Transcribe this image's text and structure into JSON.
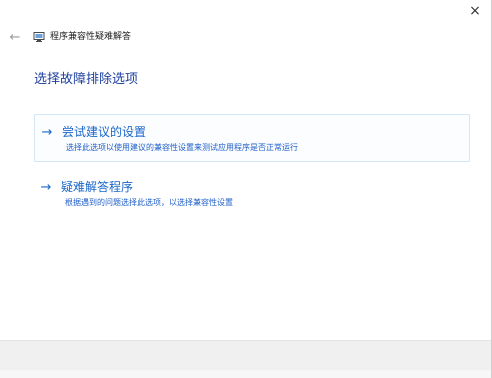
{
  "window": {
    "close_glyph": "×",
    "back_glyph": "←",
    "title": "程序兼容性疑难解答",
    "app_icon": "troubleshooter-app-icon"
  },
  "main": {
    "heading": "选择故障排除选项",
    "options": [
      {
        "icon": "arrow-right-icon",
        "arrow_glyph": "→",
        "title": "尝试建议的设置",
        "description": "选择此选项以使用建议的兼容性设置来测试应用程序是否正常运行"
      },
      {
        "icon": "arrow-right-icon",
        "arrow_glyph": "→",
        "title": "疑难解答程序",
        "description": "根据遇到的问题选择此选项，以选择兼容性设置"
      }
    ]
  },
  "colors": {
    "accent": "#1a66c8",
    "heading": "#1c3f9c",
    "footer_bg": "#f0f0f0"
  }
}
